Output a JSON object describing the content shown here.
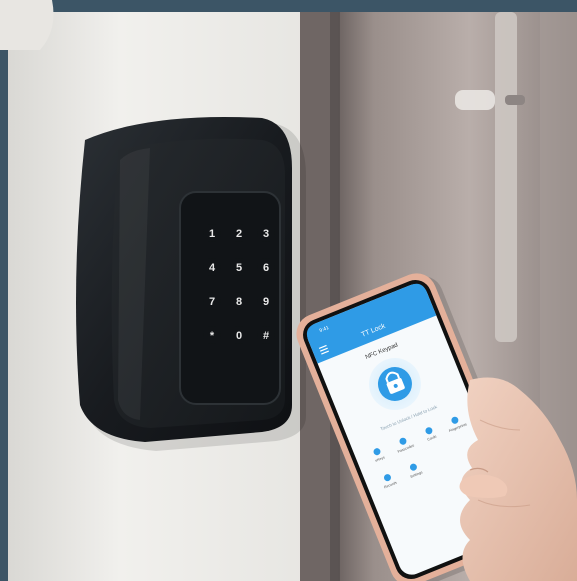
{
  "keypad": {
    "keys": [
      "1",
      "2",
      "3",
      "4",
      "5",
      "6",
      "7",
      "8",
      "9",
      "*",
      "0",
      "#"
    ]
  },
  "phone": {
    "status_time": "9:41",
    "header_title": "TT Lock",
    "device_name": "NFC Keypad",
    "hint": "Touch to Unlock / Hold to Lock",
    "menu_row1": [
      "eKeys",
      "Passcodes",
      "Cards",
      "Fingerprints"
    ],
    "menu_row2": [
      "Records",
      "Settings"
    ]
  },
  "colors": {
    "frame": "#3c5566",
    "wall": "#ececea",
    "door": "#8a7f7c",
    "device_body": "#1d2125",
    "app_accent": "#2f9be6"
  },
  "icons": [
    "lock-icon",
    "menu-icon",
    "fingerprint-icon"
  ]
}
